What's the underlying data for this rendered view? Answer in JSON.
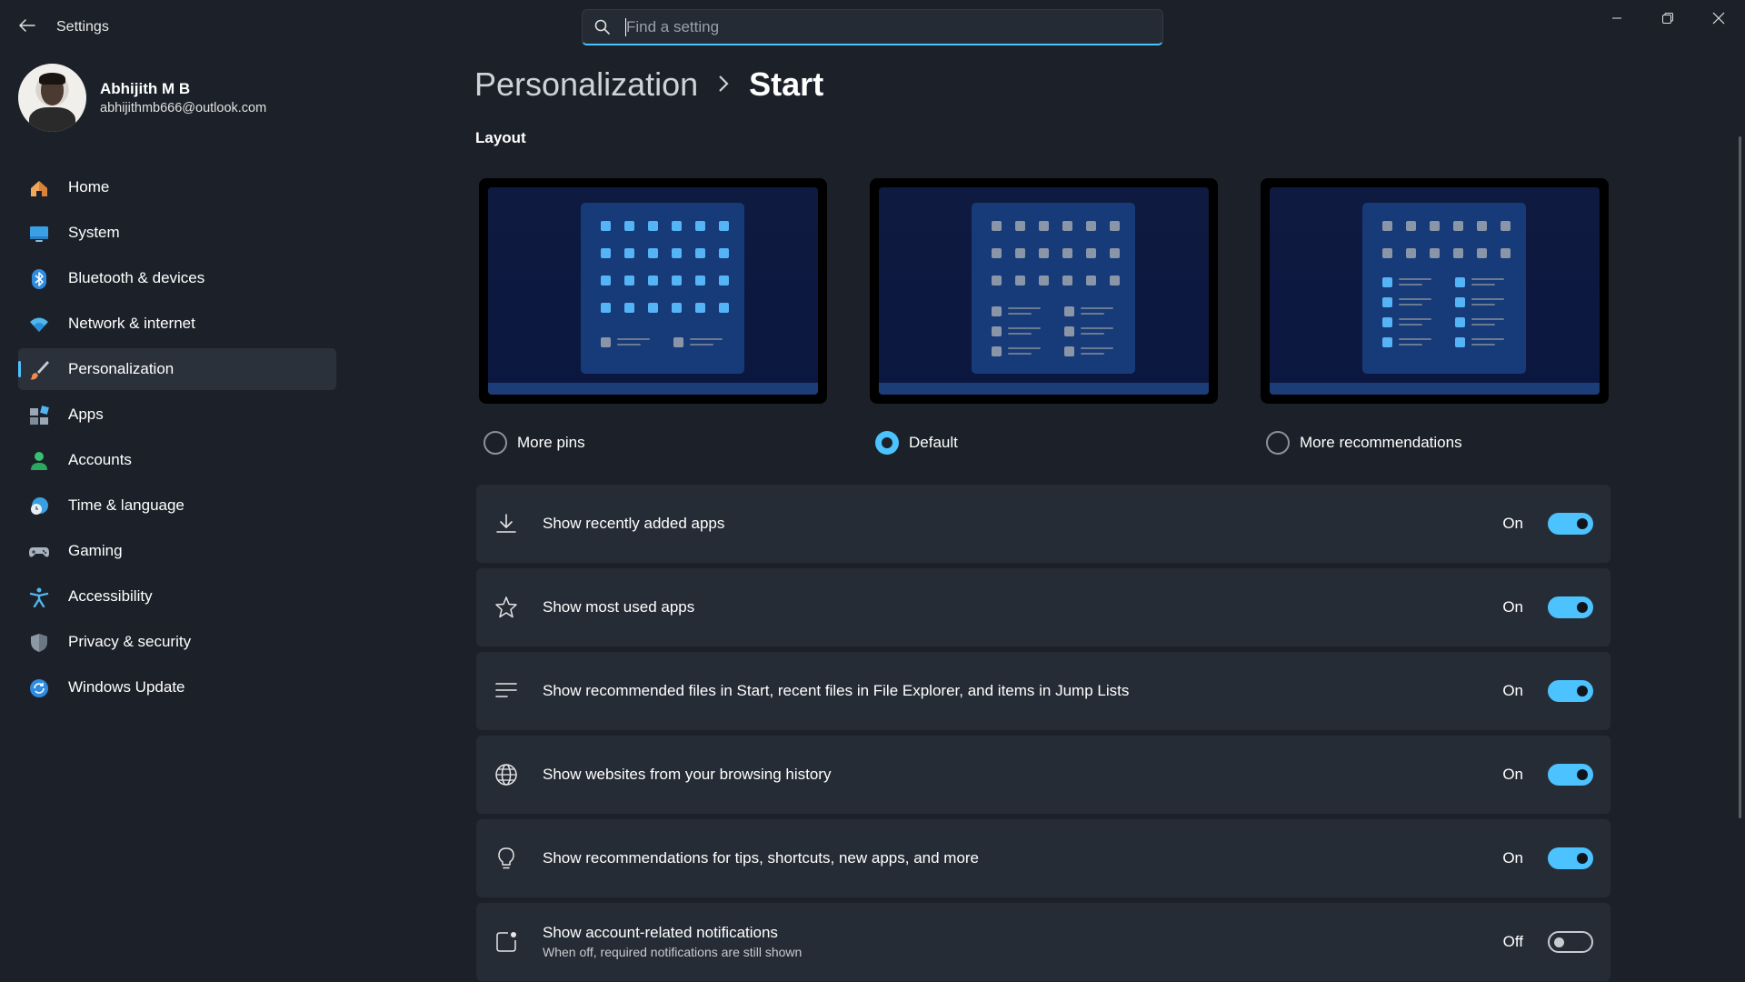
{
  "window": {
    "title": "Settings",
    "search_placeholder": "Find a setting"
  },
  "user": {
    "name": "Abhijith M B",
    "email": "abhijithmb666@outlook.com"
  },
  "sidebar": {
    "items": [
      {
        "label": "Home",
        "icon": "home-icon",
        "active": false
      },
      {
        "label": "System",
        "icon": "system-icon",
        "active": false
      },
      {
        "label": "Bluetooth & devices",
        "icon": "bluetooth-icon",
        "active": false
      },
      {
        "label": "Network & internet",
        "icon": "wifi-icon",
        "active": false
      },
      {
        "label": "Personalization",
        "icon": "brush-icon",
        "active": true
      },
      {
        "label": "Apps",
        "icon": "apps-icon",
        "active": false
      },
      {
        "label": "Accounts",
        "icon": "person-icon",
        "active": false
      },
      {
        "label": "Time & language",
        "icon": "clock-globe-icon",
        "active": false
      },
      {
        "label": "Gaming",
        "icon": "gamepad-icon",
        "active": false
      },
      {
        "label": "Accessibility",
        "icon": "accessibility-icon",
        "active": false
      },
      {
        "label": "Privacy & security",
        "icon": "shield-icon",
        "active": false
      },
      {
        "label": "Windows Update",
        "icon": "update-icon",
        "active": false
      }
    ]
  },
  "breadcrumb": {
    "parent": "Personalization",
    "separator": ">",
    "current": "Start"
  },
  "layout": {
    "title": "Layout",
    "options": [
      {
        "label": "More pins",
        "selected": false
      },
      {
        "label": "Default",
        "selected": true
      },
      {
        "label": "More recommendations",
        "selected": false
      }
    ]
  },
  "settings": [
    {
      "label": "Show recently added apps",
      "sublabel": "",
      "icon": "download-icon",
      "state": "On",
      "on": true
    },
    {
      "label": "Show most used apps",
      "sublabel": "",
      "icon": "star-icon",
      "state": "On",
      "on": true
    },
    {
      "label": "Show recommended files in Start, recent files in File Explorer, and items in Jump Lists",
      "sublabel": "",
      "icon": "list-icon",
      "state": "On",
      "on": true
    },
    {
      "label": "Show websites from your browsing history",
      "sublabel": "",
      "icon": "globe-icon",
      "state": "On",
      "on": true
    },
    {
      "label": "Show recommendations for tips, shortcuts, new apps, and more",
      "sublabel": "",
      "icon": "lightbulb-icon",
      "state": "On",
      "on": true
    },
    {
      "label": "Show account-related notifications",
      "sublabel": "When off, required notifications are still shown",
      "icon": "notification-icon",
      "state": "Off",
      "on": false
    }
  ],
  "colors": {
    "accent": "#4cc2ff",
    "background": "#1c2129",
    "card": "#262c35"
  }
}
